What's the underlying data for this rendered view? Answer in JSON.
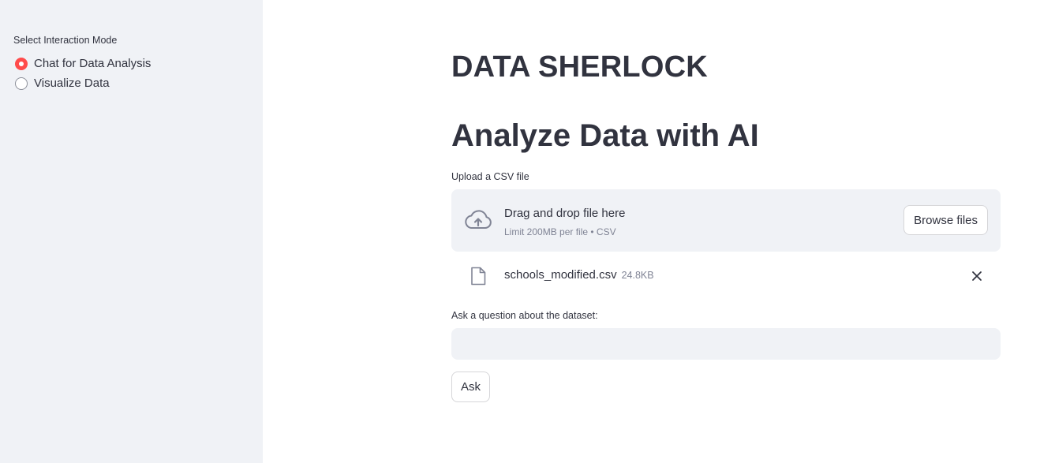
{
  "sidebar": {
    "radio_label": "Select Interaction Mode",
    "options": [
      {
        "label": "Chat for Data Analysis",
        "selected": true
      },
      {
        "label": "Visualize Data",
        "selected": false
      }
    ]
  },
  "main": {
    "title": "DATA SHERLOCK",
    "subtitle": "Analyze Data with AI",
    "uploader": {
      "label": "Upload a CSV file",
      "dropzone_title": "Drag and drop file here",
      "dropzone_limit": "Limit 200MB per file • CSV",
      "browse_label": "Browse files",
      "file": {
        "name": "schools_modified.csv",
        "size": "24.8KB"
      }
    },
    "question": {
      "label": "Ask a question about the dataset:",
      "value": "",
      "placeholder": ""
    },
    "ask_label": "Ask"
  },
  "colors": {
    "accent": "#ff4b4b",
    "sidebar_bg": "#f0f2f6",
    "text": "#31333f",
    "muted": "#808495"
  },
  "icons": {
    "upload": "cloud-upload-icon",
    "file": "file-icon",
    "remove": "close-icon"
  }
}
